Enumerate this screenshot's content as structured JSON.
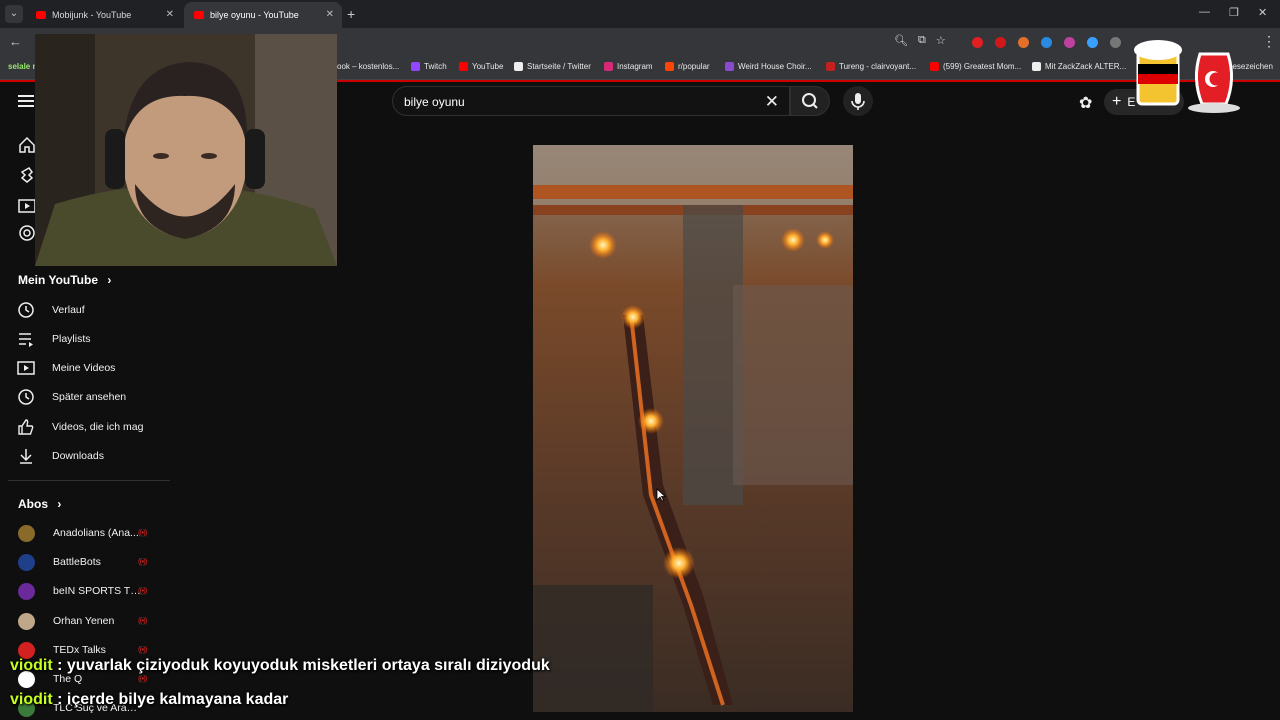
{
  "browser": {
    "tabs": [
      {
        "title": "Mobijunk - YouTube",
        "active": false
      },
      {
        "title": "bilye oyunu - YouTube",
        "active": true
      }
    ],
    "bookmarks": [
      {
        "label": "selale n",
        "icon": "bookmark-icon"
      },
      {
        "label": "ook – kostenlos...",
        "icon": "facebook-icon"
      },
      {
        "label": "Twitch",
        "icon": "twitch-icon"
      },
      {
        "label": "YouTube",
        "icon": "youtube-icon"
      },
      {
        "label": "Startseite / Twitter",
        "icon": "x-icon"
      },
      {
        "label": "Instagram",
        "icon": "instagram-icon"
      },
      {
        "label": "r/popular",
        "icon": "reddit-icon"
      },
      {
        "label": "Weird House Choir...",
        "icon": "site-icon"
      },
      {
        "label": "Tureng - clairvoyant...",
        "icon": "tureng-icon"
      },
      {
        "label": "(599) Greatest Mom...",
        "icon": "youtube-icon"
      },
      {
        "label": "Mit ZackZack ALTER...",
        "icon": "site-icon"
      },
      {
        "label": "Lesezeichen",
        "icon": "folder-icon"
      }
    ]
  },
  "youtube": {
    "search_query": "bilye oyunu",
    "create_label": "E",
    "sidebar": {
      "you_heading": "Mein YouTube",
      "you_items": [
        {
          "label": "Verlauf",
          "icon": "history-icon"
        },
        {
          "label": "Playlists",
          "icon": "playlists-icon"
        },
        {
          "label": "Meine Videos",
          "icon": "my-videos-icon"
        },
        {
          "label": "Später ansehen",
          "icon": "watch-later-icon"
        },
        {
          "label": "Videos, die ich mag",
          "icon": "thumbs-up-icon"
        },
        {
          "label": "Downloads",
          "icon": "download-icon"
        }
      ],
      "subs_heading": "Abos",
      "subscriptions": [
        {
          "name": "Anadolians (Ana...",
          "live": true,
          "color": "#8a6a2a"
        },
        {
          "name": "BattleBots",
          "live": true,
          "color": "#1f3f8a"
        },
        {
          "name": "beIN SPORTS Tü...",
          "live": true,
          "color": "#6a2a9a"
        },
        {
          "name": "Orhan Yenen",
          "live": true,
          "color": "#bfa88a"
        },
        {
          "name": "TEDx Talks",
          "live": true,
          "color": "#d32020"
        },
        {
          "name": "The Q",
          "live": true,
          "color": "#ffffff"
        },
        {
          "name": "TLC Suç ve Araşt...",
          "live": false,
          "color": "#3a7a3a"
        }
      ]
    }
  },
  "chat": [
    {
      "user": "viodit",
      "separator": " : ",
      "message": "yuvarlak çiziyoduk koyuyoduk misketleri ortaya sıralı diziyoduk"
    },
    {
      "user": "viodit",
      "separator": " : ",
      "message": "içerde bilye kalmayana kadar"
    }
  ],
  "colors": {
    "chat_user": "#c4ff1f",
    "youtube_red": "#ff0000",
    "background": "#0f0f0f"
  }
}
